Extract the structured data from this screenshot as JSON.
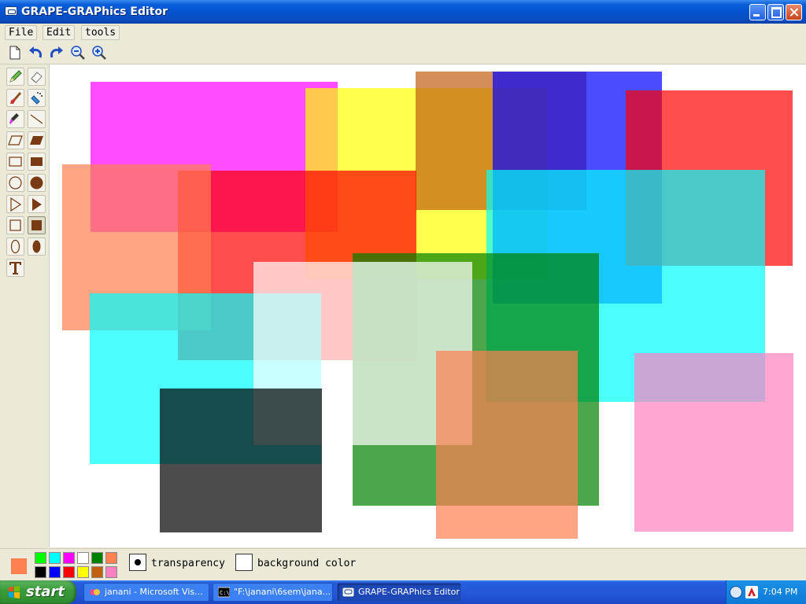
{
  "window": {
    "title": "GRAPE-GRAPhics Editor",
    "app_icon": "window-icon",
    "controls": [
      "minimize-icon",
      "maximize-icon",
      "close-icon"
    ]
  },
  "menu": {
    "file": "File",
    "edit": "Edit",
    "tools": "tools"
  },
  "toolbar": {
    "icons": [
      "new-document-icon",
      "undo-icon",
      "redo-icon",
      "zoom-out-icon",
      "zoom-in-icon"
    ]
  },
  "palette": {
    "tools": [
      "pencil-tool",
      "eraser-tool",
      "brush-tool",
      "spray-can-tool",
      "color-picker-tool",
      "line-tool",
      "parallelogram-outline-tool",
      "parallelogram-filled-tool",
      "rectangle-outline-tool",
      "rectangle-filled-tool",
      "circle-outline-tool",
      "circle-filled-tool",
      "triangle-outline-tool",
      "triangle-filled-tool",
      "square-outline-tool",
      "square-filled-tool",
      "ellipse-outline-tool",
      "ellipse-filled-tool",
      "text-tool"
    ],
    "shape_color": "#7a3a14"
  },
  "canvas": {
    "background": "#ffffff"
  },
  "colors": {
    "current": "#ff7f50",
    "swatches": [
      "#00ff00",
      "#00ffff",
      "#ff00ff",
      "#ffffff",
      "#008000",
      "#ff7f50",
      "#000000",
      "#0000ff",
      "#ff0000",
      "#ffff00",
      "#c06010",
      "#ff80c0"
    ]
  },
  "options": {
    "transparency_label": "transparency",
    "transparency_checked": true,
    "background_color_label": "background color",
    "background_color_checked": false
  },
  "taskbar": {
    "start_label": "start",
    "tasks": [
      {
        "label": "janani - Microsoft Vis...",
        "icon": "visual-studio-icon"
      },
      {
        "label": "\"F:\\janani\\6sem\\jana...",
        "icon": "console-icon"
      },
      {
        "label": "GRAPE-GRAPhics Editor",
        "icon": "window-icon"
      }
    ],
    "clock": "7:04 PM"
  }
}
